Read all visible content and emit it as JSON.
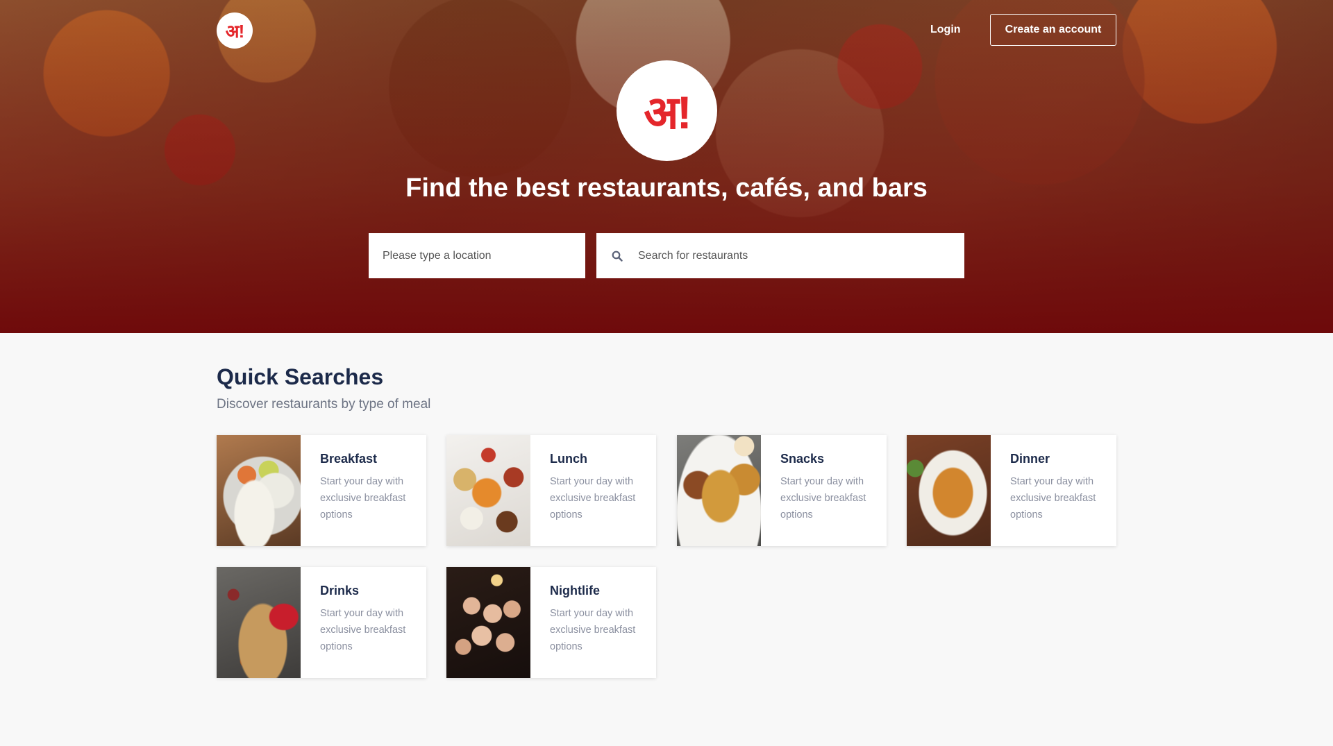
{
  "header": {
    "logo_text": "अ!",
    "login_label": "Login",
    "create_account_label": "Create an account"
  },
  "hero": {
    "logo_text": "अ!",
    "title": "Find the best restaurants, cafés, and bars",
    "location_placeholder": "Please type a location",
    "search_placeholder": "Search for restaurants",
    "search_icon": "search-icon"
  },
  "quick_searches": {
    "title": "Quick Searches",
    "subtitle": "Discover restaurants by type of meal",
    "cards": [
      {
        "title": "Breakfast",
        "desc": "Start your day with exclusive breakfast options"
      },
      {
        "title": "Lunch",
        "desc": "Start your day with exclusive breakfast options"
      },
      {
        "title": "Snacks",
        "desc": "Start your day with exclusive breakfast options"
      },
      {
        "title": "Dinner",
        "desc": "Start your day with exclusive breakfast options"
      },
      {
        "title": "Drinks",
        "desc": "Start your day with exclusive breakfast options"
      },
      {
        "title": "Nightlife",
        "desc": "Start your day with exclusive breakfast options"
      }
    ]
  },
  "colors": {
    "brand_red": "#e4262b",
    "hero_bottom": "#6e080a",
    "heading_navy": "#1c2a4a",
    "muted_text": "#8b90a0"
  }
}
